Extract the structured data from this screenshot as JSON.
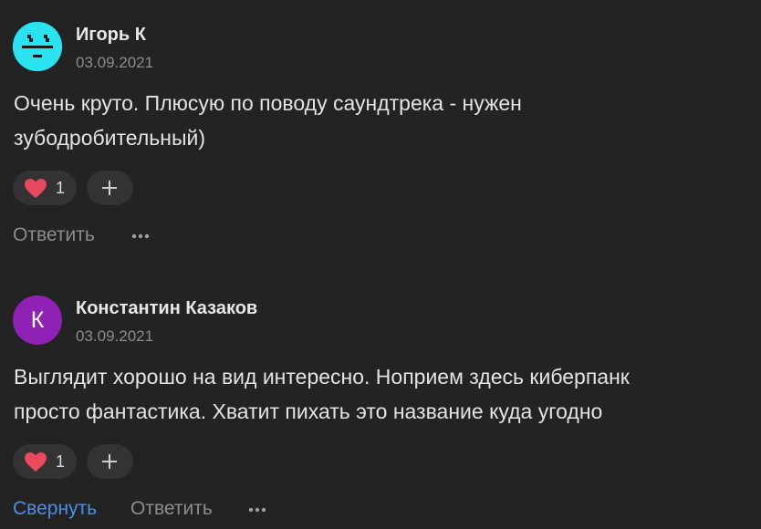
{
  "comments": [
    {
      "author": "Игорь К",
      "date": "03.09.2021",
      "text_lines": [
        "Очень круто. Плюсую по поводу саундтрека - нужен",
        "зубодробительный)"
      ],
      "likes": "1",
      "avatar_icon": "robot-face-avatar",
      "avatar_color": "#29e4f0",
      "actions": {
        "reply": "Ответить"
      }
    },
    {
      "author": "Константин Казаков",
      "date": "03.09.2021",
      "avatar_letter": "К",
      "avatar_color": "#8f21b4",
      "text_lines": [
        "Выглядит хорошо на вид интересно. Ноприем здесь киберпанк",
        "просто фантастика. Хватит пихать это название куда угодно"
      ],
      "likes": "1",
      "actions": {
        "collapse": "Свернуть",
        "reply": "Ответить"
      }
    }
  ],
  "icons": {
    "like": "heart-icon",
    "add_reaction": "plus-icon",
    "more": "more-dots-icon"
  },
  "colors": {
    "background": "#232323",
    "heart": "#e8495d",
    "link": "#4d8fe6",
    "muted": "#8c8c8c"
  }
}
